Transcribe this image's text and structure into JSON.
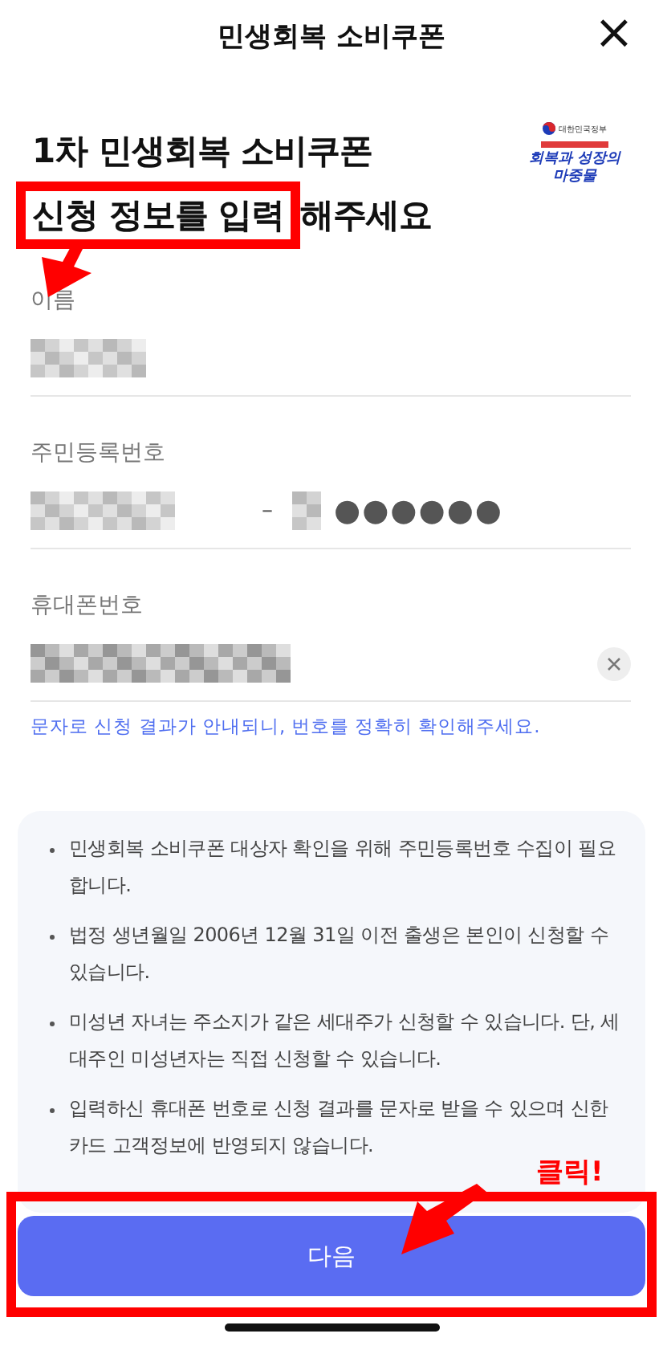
{
  "header": {
    "title": "민생회복 소비쿠폰",
    "close": "×"
  },
  "heading": {
    "lines": [
      [
        {
          "text": "1차 민생회복 소비쿠폰",
          "highlight": false
        }
      ],
      [
        {
          "text": "신청 정보를 입력",
          "highlight": true
        },
        {
          "text": "해주세요",
          "highlight": false
        }
      ]
    ]
  },
  "logo": {
    "org": "대한민국정부",
    "slogan": [
      "회복과 성장의",
      "마중물"
    ]
  },
  "fields": [
    {
      "kind": "name",
      "label": "이름"
    },
    {
      "kind": "id",
      "label": "주민등록번호",
      "separator": "–",
      "mask": "●●●●●●"
    },
    {
      "kind": "phone",
      "label": "휴대폰번호",
      "clearable": true,
      "hint": "문자로 신청 결과가 안내되니, 번호를 정확히 확인해주세요."
    }
  ],
  "notices": [
    "민생회복 소비쿠폰 대상자 확인을 위해 주민등록번호 수집이 필요합니다.",
    "법정 생년월일 2006년 12월 31일 이전 출생은 본인이 신청할 수 있습니다.",
    "미성년 자녀는 주소지가 같은 세대주가 신청할 수 있습니다. 단, 세대주인 미성년자는 직접 신청할 수 있습니다.",
    "입력하신 휴대폰 번호로 신청 결과를 문자로 받을 수 있으며 신한카드 고객정보에 반영되지 않습니다."
  ],
  "next_button": "다음",
  "annotation": {
    "callout": "클릭!"
  }
}
